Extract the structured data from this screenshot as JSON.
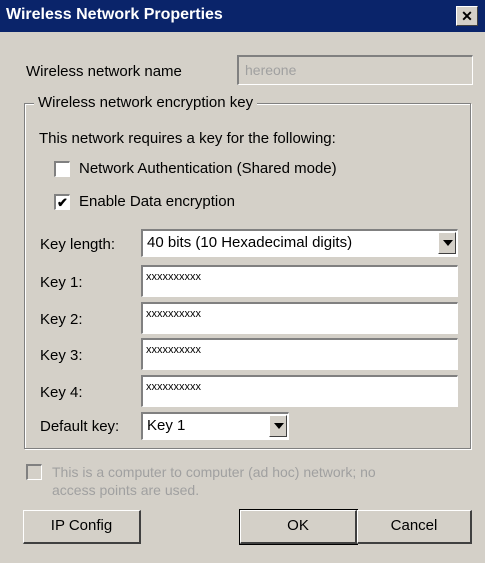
{
  "window": {
    "title": "Wireless Network Properties",
    "close_glyph": "✕"
  },
  "network_name": {
    "label": "Wireless network name",
    "value": "hereone"
  },
  "encryption_group": {
    "legend": "Wireless network encryption key",
    "requires_text": "This network requires a key for the following:",
    "network_auth": {
      "label": "Network  Authentication (Shared mode)",
      "checked": false
    },
    "data_encryption": {
      "label": "Enable Data encryption",
      "checked": true
    },
    "key_length": {
      "label": "Key length:",
      "value": "40 bits (10 Hexadecimal digits)"
    },
    "keys": [
      {
        "label": "Key 1:",
        "value": "xxxxxxxxxx"
      },
      {
        "label": "Key 2:",
        "value": "xxxxxxxxxx"
      },
      {
        "label": "Key 3:",
        "value": "xxxxxxxxxx"
      },
      {
        "label": "Key 4:",
        "value": "xxxxxxxxxx"
      }
    ],
    "default_key": {
      "label": "Default key:",
      "value": "Key 1"
    }
  },
  "adhoc": {
    "line1": "This is a computer to computer (ad hoc) network; no",
    "line2": "access points are used.",
    "checked": false,
    "enabled": false
  },
  "buttons": {
    "ip_config": "IP Config",
    "ok": "OK",
    "cancel": "Cancel"
  },
  "icons": {
    "close": "close-icon",
    "dropdown": "chevron-down-icon",
    "check": "checkmark-icon"
  }
}
